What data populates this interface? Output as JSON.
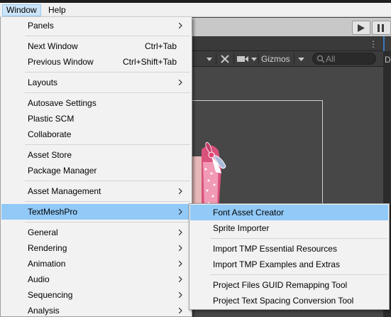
{
  "menubar": {
    "items": [
      {
        "label": "Window",
        "active": true
      },
      {
        "label": "Help",
        "active": false
      }
    ]
  },
  "scene": {
    "gizmos_label": "Gizmos",
    "search_placeholder": "All",
    "right_panel_letter": "D"
  },
  "window_menu": {
    "items": [
      {
        "label": "Panels",
        "submenu": true
      },
      {
        "label": "Next Window",
        "shortcut": "Ctrl+Tab"
      },
      {
        "label": "Previous Window",
        "shortcut": "Ctrl+Shift+Tab"
      },
      {
        "label": "Layouts",
        "submenu": true
      },
      {
        "label": "Autosave Settings"
      },
      {
        "label": "Plastic SCM"
      },
      {
        "label": "Collaborate"
      },
      {
        "label": "Asset Store"
      },
      {
        "label": "Package Manager"
      },
      {
        "label": "Asset Management",
        "submenu": true
      },
      {
        "label": "TextMeshPro",
        "submenu": true,
        "highlighted": true
      },
      {
        "label": "General",
        "submenu": true
      },
      {
        "label": "Rendering",
        "submenu": true
      },
      {
        "label": "Animation",
        "submenu": true
      },
      {
        "label": "Audio",
        "submenu": true
      },
      {
        "label": "Sequencing",
        "submenu": true
      },
      {
        "label": "Analysis",
        "submenu": true
      }
    ]
  },
  "textmeshpro_submenu": {
    "items": [
      {
        "label": "Font Asset Creator",
        "highlighted": true
      },
      {
        "label": "Sprite Importer"
      },
      {
        "label": "Import TMP Essential Resources"
      },
      {
        "label": "Import TMP Examples and Extras"
      },
      {
        "label": "Project Files GUID Remapping Tool"
      },
      {
        "label": "Project Text Spacing Conversion Tool"
      }
    ]
  },
  "colors": {
    "menu_highlight": "#91c9f7",
    "menubar_active": "#cce4f7",
    "scene_bg": "#474747"
  }
}
